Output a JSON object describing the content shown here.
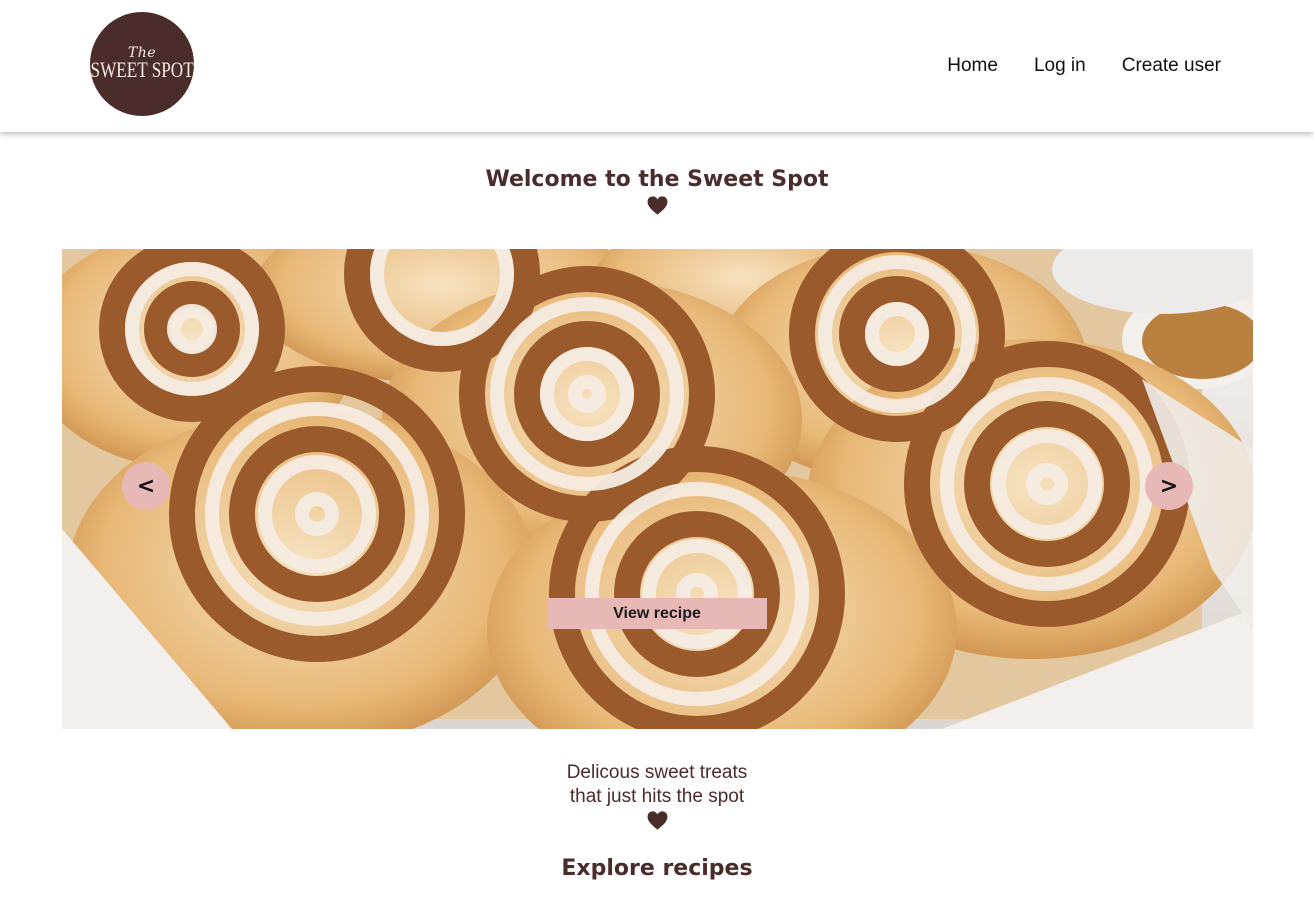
{
  "logo": {
    "line1": "The",
    "line2": "SWEET SPOT",
    "background_color": "#4a2c2a"
  },
  "nav": {
    "items": [
      {
        "label": "Home"
      },
      {
        "label": "Log in"
      },
      {
        "label": "Create user"
      }
    ]
  },
  "welcome": {
    "title": "Welcome to the Sweet Spot",
    "icon": "heart-icon"
  },
  "carousel": {
    "image": "cinnamon-rolls-photo",
    "prev_label": "<",
    "next_label": ">",
    "cta_label": "View recipe",
    "button_color": "#e8b8b6"
  },
  "tagline": {
    "line1": "Delicous sweet treats",
    "line2": "that just hits the spot",
    "icon": "heart-icon"
  },
  "explore": {
    "title": "Explore recipes"
  },
  "colors": {
    "brand_brown": "#4a2c2a",
    "accent_pink": "#e8b8b6"
  }
}
